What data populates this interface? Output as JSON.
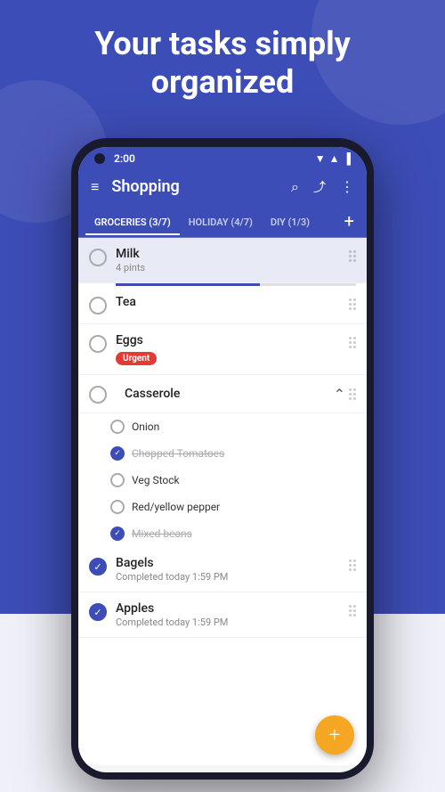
{
  "hero": {
    "line1": "Your tasks simply",
    "line2": "organized"
  },
  "status_bar": {
    "time": "2:00",
    "icons": "▼▲4"
  },
  "app_bar": {
    "title": "Shopping",
    "menu_icon": "≡",
    "search_icon": "⌕",
    "share_icon": "⬆",
    "more_icon": "⋮"
  },
  "tabs": [
    {
      "label": "GROCERIES (3/7)",
      "active": true
    },
    {
      "label": "HOLIDAY (4/7)",
      "active": false
    },
    {
      "label": "DIY (1/3)",
      "active": false
    }
  ],
  "tasks": [
    {
      "id": "milk",
      "title": "Milk",
      "subtitle": "4 pints",
      "highlighted": true,
      "checked": false,
      "progress": 60
    },
    {
      "id": "tea",
      "title": "Tea",
      "subtitle": "",
      "highlighted": false,
      "checked": false,
      "progress": null
    },
    {
      "id": "eggs",
      "title": "Eggs",
      "subtitle": "",
      "highlighted": false,
      "checked": false,
      "badge": "Urgent",
      "progress": null
    },
    {
      "id": "casserole",
      "title": "Casserole",
      "highlighted": false,
      "checked": false,
      "expanded": true,
      "sub_items": [
        {
          "label": "Onion",
          "checked": false,
          "strikethrough": false
        },
        {
          "label": "Chopped Tomatoes",
          "checked": true,
          "strikethrough": true
        },
        {
          "label": "Veg Stock",
          "checked": false,
          "strikethrough": false
        },
        {
          "label": "Red/yellow pepper",
          "checked": false,
          "strikethrough": false
        },
        {
          "label": "Mixed beans",
          "checked": true,
          "strikethrough": true
        }
      ]
    },
    {
      "id": "bagels",
      "title": "Bagels",
      "subtitle": "Completed today 1:59 PM",
      "checked": true
    },
    {
      "id": "apples",
      "title": "Apples",
      "subtitle": "Completed today 1:59 PM",
      "checked": true
    }
  ],
  "colors": {
    "brand": "#3d4db7",
    "urgent": "#e53935",
    "fab": "#f5a623",
    "checked": "#3d4db7"
  }
}
